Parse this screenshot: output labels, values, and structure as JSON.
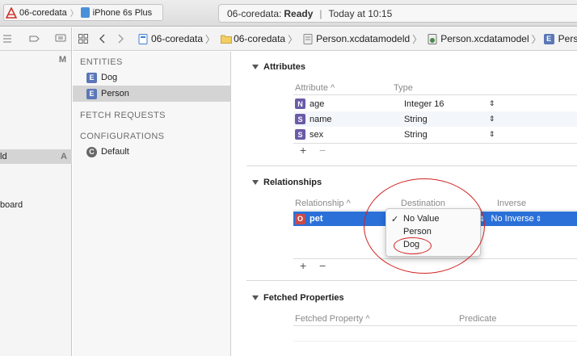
{
  "toolbar": {
    "scheme_name": "06-coredata",
    "device_name": "iPhone 6s Plus",
    "activity_project": "06-coredata:",
    "activity_status": "Ready",
    "activity_separator": "|",
    "activity_time": "Today at 10:15"
  },
  "navigator": {
    "header_badge": "M",
    "rows": [
      {
        "label": "ld",
        "badge": "A"
      },
      {
        "label": "board",
        "badge": ""
      }
    ]
  },
  "jumpbar": {
    "items": [
      "06-coredata",
      "06-coredata",
      "Person.xcdatamodeld",
      "Person.xcdatamodel",
      "Person"
    ]
  },
  "outline": {
    "entities_header": "ENTITIES",
    "entities": [
      {
        "badge": "E",
        "label": "Dog"
      },
      {
        "badge": "E",
        "label": "Person"
      }
    ],
    "fetch_header": "FETCH REQUESTS",
    "config_header": "CONFIGURATIONS",
    "configurations": [
      {
        "badge": "C",
        "label": "Default"
      }
    ]
  },
  "attributes": {
    "title": "Attributes",
    "col_attribute": "Attribute ^",
    "col_type": "Type",
    "rows": [
      {
        "badge": "N",
        "name": "age",
        "type": "Integer 16"
      },
      {
        "badge": "S",
        "name": "name",
        "type": "String"
      },
      {
        "badge": "S",
        "name": "sex",
        "type": "String"
      }
    ],
    "add": "+",
    "remove": "−"
  },
  "relationships": {
    "title": "Relationships",
    "col_relationship": "Relationship ^",
    "col_destination": "Destination",
    "col_inverse": "Inverse",
    "row": {
      "badge": "O",
      "name": "pet",
      "inverse": "No Inverse"
    },
    "add": "+",
    "remove": "−",
    "popup": {
      "checkmark": "✓",
      "options": [
        "No Value",
        "Person",
        "Dog"
      ],
      "selected": "No Value"
    }
  },
  "fetched": {
    "title": "Fetched Properties",
    "col_property": "Fetched Property ^",
    "col_predicate": "Predicate"
  },
  "colors": {
    "selection": "#2b70d8",
    "annotation": "#d32020"
  }
}
